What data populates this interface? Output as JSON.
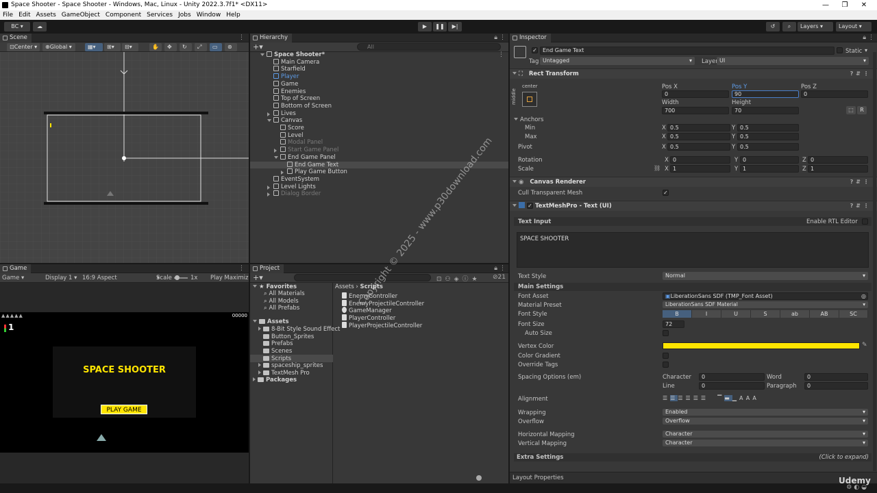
{
  "window": {
    "title": "Space Shooter - Space Shooter - Windows, Mac, Linux - Unity 2022.3.7f1* <DX11>",
    "minimize": "—",
    "maximize": "❐",
    "close": "✕"
  },
  "menu": [
    "File",
    "Edit",
    "Assets",
    "GameObject",
    "Component",
    "Services",
    "Jobs",
    "Window",
    "Help"
  ],
  "toolbar": {
    "account": "BC ▾",
    "layers": "Layers",
    "layout": "Layout"
  },
  "scene": {
    "tab": "Scene",
    "pivot": "Center",
    "space": "Global"
  },
  "game": {
    "tab": "Game",
    "display_mode": "Game",
    "display": "Display 1",
    "aspect": "16:9 Aspect",
    "scale_label": "Scale",
    "scale_value": "1x",
    "play_mode": "Play Maximize",
    "score": "00000",
    "lives_count": "1",
    "title_text": "SPACE SHOOTER",
    "button_text": "PLAY GAME"
  },
  "hierarchy": {
    "tab": "Hierarchy",
    "search_placeholder": "All",
    "items": [
      {
        "label": "Space Shooter*",
        "indent": 0,
        "expand": "down",
        "root": true,
        "dim": false,
        "selected": false,
        "blue": false
      },
      {
        "label": "Main Camera",
        "indent": 1,
        "expand": "",
        "dim": false,
        "selected": false,
        "blue": false
      },
      {
        "label": "Starfield",
        "indent": 1,
        "expand": "",
        "dim": false,
        "selected": false,
        "blue": false
      },
      {
        "label": "Player",
        "indent": 1,
        "expand": "",
        "dim": false,
        "selected": false,
        "blue": true
      },
      {
        "label": "Game",
        "indent": 1,
        "expand": "",
        "dim": false,
        "selected": false,
        "blue": false
      },
      {
        "label": "Enemies",
        "indent": 1,
        "expand": "",
        "dim": false,
        "selected": false,
        "blue": false
      },
      {
        "label": "Top of Screen",
        "indent": 1,
        "expand": "",
        "dim": false,
        "selected": false,
        "blue": false
      },
      {
        "label": "Bottom of Screen",
        "indent": 1,
        "expand": "",
        "dim": false,
        "selected": false,
        "blue": false
      },
      {
        "label": "Lives",
        "indent": 1,
        "expand": "right",
        "dim": false,
        "selected": false,
        "blue": false
      },
      {
        "label": "Canvas",
        "indent": 1,
        "expand": "down",
        "dim": false,
        "selected": false,
        "blue": false
      },
      {
        "label": "Score",
        "indent": 2,
        "expand": "",
        "dim": false,
        "selected": false,
        "blue": false
      },
      {
        "label": "Level",
        "indent": 2,
        "expand": "",
        "dim": false,
        "selected": false,
        "blue": false
      },
      {
        "label": "Modal Panel",
        "indent": 2,
        "expand": "",
        "dim": true,
        "selected": false,
        "blue": false
      },
      {
        "label": "Start Game Panel",
        "indent": 2,
        "expand": "right",
        "dim": true,
        "selected": false,
        "blue": false
      },
      {
        "label": "End Game Panel",
        "indent": 2,
        "expand": "down",
        "dim": false,
        "selected": false,
        "blue": false
      },
      {
        "label": "End Game Text",
        "indent": 3,
        "expand": "",
        "dim": false,
        "selected": true,
        "blue": false
      },
      {
        "label": "Play Game Button",
        "indent": 3,
        "expand": "right",
        "dim": false,
        "selected": false,
        "blue": false
      },
      {
        "label": "EventSystem",
        "indent": 1,
        "expand": "",
        "dim": false,
        "selected": false,
        "blue": false
      },
      {
        "label": "Level Lights",
        "indent": 1,
        "expand": "right",
        "dim": false,
        "selected": false,
        "blue": false
      },
      {
        "label": "Dialog Border",
        "indent": 1,
        "expand": "right",
        "dim": true,
        "selected": false,
        "blue": false
      }
    ]
  },
  "project": {
    "tab": "Project",
    "count": "21",
    "favorites": {
      "label": "Favorites",
      "items": [
        "All Materials",
        "All Models",
        "All Prefabs"
      ]
    },
    "assets": {
      "label": "Assets",
      "items": [
        "8-Bit Style Sound Effect",
        "Button_Sprites",
        "Prefabs",
        "Scenes",
        "Scripts",
        "spaceship_sprites",
        "TextMesh Pro"
      ]
    },
    "packages": "Packages",
    "breadcrumb": [
      "Assets",
      "Scripts"
    ],
    "files": [
      "EnemyController",
      "EnemyProjectileController",
      "GameManager",
      "PlayerController",
      "PlayerProjectileController"
    ]
  },
  "inspector": {
    "tab": "Inspector",
    "object_name": "End Game Text",
    "static_label": "Static",
    "tag_label": "Tag",
    "tag_value": "Untagged",
    "layer_label": "Layer",
    "layer_value": "UI",
    "rect": {
      "title": "Rect Transform",
      "anchor_h": "center",
      "anchor_v": "middle",
      "pos_x_label": "Pos X",
      "pos_x": "0",
      "pos_y_label": "Pos Y",
      "pos_y": "90",
      "pos_z_label": "Pos Z",
      "pos_z": "0",
      "width_label": "Width",
      "width": "700",
      "height_label": "Height",
      "height": "70",
      "anchors_label": "Anchors",
      "min_label": "Min",
      "min_x": "0.5",
      "min_y": "0.5",
      "max_label": "Max",
      "max_x": "0.5",
      "max_y": "0.5",
      "pivot_label": "Pivot",
      "pivot_x": "0.5",
      "pivot_y": "0.5",
      "rotation_label": "Rotation",
      "rot_x": "0",
      "rot_y": "0",
      "rot_z": "0",
      "scale_label": "Scale",
      "scale_x": "1",
      "scale_y": "1",
      "scale_z": "1",
      "btn_r": "R"
    },
    "renderer": {
      "title": "Canvas Renderer",
      "cull_label": "Cull Transparent Mesh"
    },
    "tmp": {
      "title": "TextMeshPro - Text (UI)",
      "text_input_label": "Text Input",
      "rtl_label": "Enable RTL Editor",
      "text_value": "SPACE SHOOTER",
      "text_style_label": "Text Style",
      "text_style": "Normal",
      "main_settings": "Main Settings",
      "font_asset_label": "Font Asset",
      "font_asset": "LiberationSans SDF (TMP_Font Asset)",
      "material_label": "Material Preset",
      "material": "LiberationSans SDF Material",
      "font_style_label": "Font Style",
      "font_styles": [
        "B",
        "I",
        "U",
        "S",
        "ab",
        "AB",
        "SC"
      ],
      "font_size_label": "Font Size",
      "font_size": "72",
      "auto_size_label": "Auto Size",
      "vertex_color_label": "Vertex Color",
      "vertex_color": "#ffe500",
      "gradient_label": "Color Gradient",
      "override_label": "Override Tags",
      "spacing_label": "Spacing Options (em)",
      "character_label": "Character",
      "character": "0",
      "word_label": "Word",
      "word": "0",
      "line_label": "Line",
      "line": "0",
      "paragraph_label": "Paragraph",
      "paragraph": "0",
      "alignment_label": "Alignment",
      "wrapping_label": "Wrapping",
      "wrapping": "Enabled",
      "overflow_label": "Overflow",
      "overflow": "Overflow",
      "hmap_label": "Horizontal Mapping",
      "hmap": "Character",
      "vmap_label": "Vertical Mapping",
      "vmap": "Character",
      "extra_label": "Extra Settings",
      "extra_hint": "(Click to expand)"
    },
    "layout_props": "Layout Properties"
  },
  "watermark": "Copyright © 2025 - www.p30download.com",
  "brand": "Udemy"
}
